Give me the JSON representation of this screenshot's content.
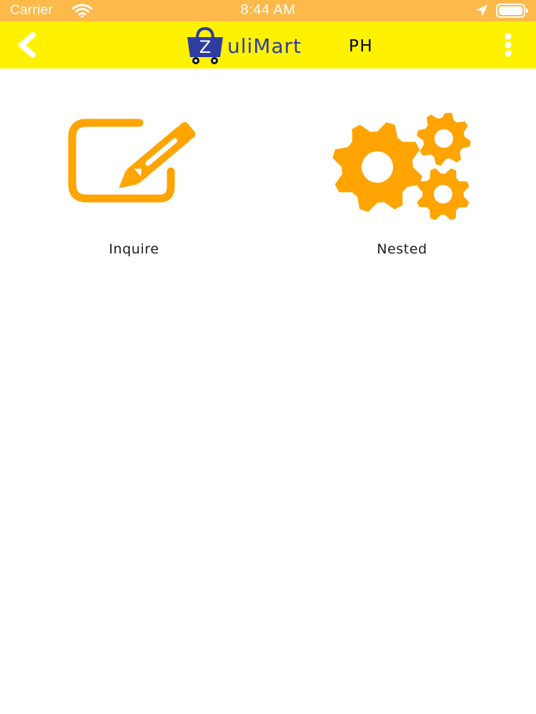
{
  "status_bar": {
    "carrier": "Carrier",
    "time": "8:44 AM",
    "icons": [
      "wifi-icon",
      "location-arrow-icon",
      "battery-icon"
    ],
    "background": "#fdb94a"
  },
  "header": {
    "brand_logo_letter": "Z",
    "brand_name": "uliMart",
    "brand_suffix": "PH",
    "background": "#fff200",
    "brand_color": "#2f3da0",
    "icons": [
      "back-chevron-icon",
      "more-vertical-icon"
    ]
  },
  "menu": {
    "accent": "#ffa400",
    "items": [
      {
        "label": "Inquire",
        "icon": "edit-pencil-icon"
      },
      {
        "label": "Nested",
        "icon": "gears-icon"
      }
    ]
  }
}
